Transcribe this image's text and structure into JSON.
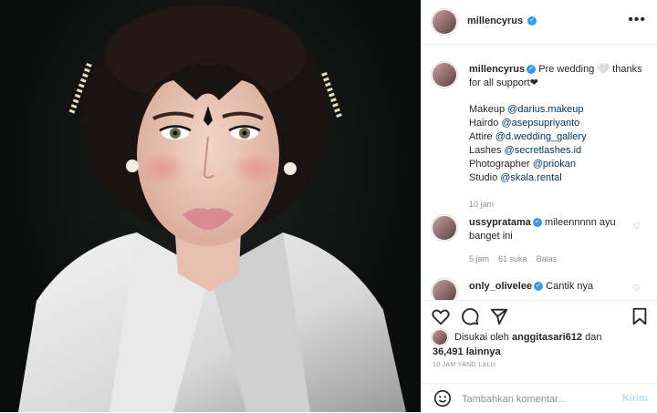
{
  "post": {
    "author": "millencyrus",
    "caption_text": "Pre wedding 🤍 thanks for all support❤",
    "credits": [
      {
        "role": "Makeup",
        "handle": "@darius.makeup"
      },
      {
        "role": "Hairdo",
        "handle": "@asepsupriyanto"
      },
      {
        "role": "Attire",
        "handle": "@d.wedding_gallery"
      },
      {
        "role": "Lashes",
        "handle": "@secretlashes.id"
      },
      {
        "role": "Photographer",
        "handle": "@priokan"
      },
      {
        "role": "Studio",
        "handle": "@skala.rental"
      }
    ],
    "caption_time": "10 jam"
  },
  "comments": [
    {
      "user": "ussypratama",
      "text": "mileennnnn ayu banget ini",
      "time": "5 jam",
      "likes": "61 suka",
      "reply": "Balas"
    },
    {
      "user": "only_olivelee",
      "text": "Cantik nya"
    }
  ],
  "likes": {
    "prefix": "Disukai oleh",
    "user": "anggitasari612",
    "middle": "dan",
    "count": "36,491",
    "suffix": "lainnya"
  },
  "timestamp": "10 JAM YANG LALU",
  "add_comment": {
    "placeholder": "Tambahkan komentar...",
    "post_label": "Kirim"
  },
  "icons": {
    "more": "more-options-icon",
    "like": "heart-icon",
    "comment": "comment-icon",
    "share": "share-icon",
    "save": "bookmark-icon",
    "emoji": "emoji-icon"
  },
  "colors": {
    "link": "#00376b",
    "verified": "#3897f0",
    "post_button": "#b2dffc"
  }
}
